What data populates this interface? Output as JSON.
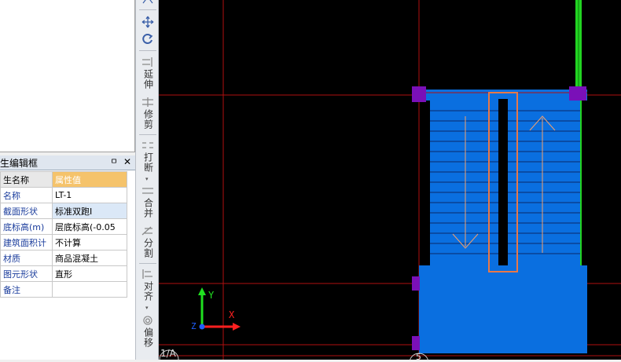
{
  "property_panel": {
    "title": "生编辑框",
    "pin_glyph": "ㅁ",
    "close_glyph": "✕",
    "header": {
      "name_col": "生名称",
      "value_col": "属性值"
    },
    "rows": [
      {
        "name": "名称",
        "value": "LT-1"
      },
      {
        "name": "截面形状",
        "value": "标准双跑I"
      },
      {
        "name": "底标高(m)",
        "value": "层底标高(-0.05"
      },
      {
        "name": "建筑面积计",
        "value": "不计算"
      },
      {
        "name": "材质",
        "value": "商品混凝土"
      },
      {
        "name": "图元形状",
        "value": "直形"
      },
      {
        "name": "备注",
        "value": ""
      }
    ]
  },
  "toolbar": {
    "items": [
      {
        "icon": "move-icon",
        "label": ""
      },
      {
        "icon": "rotate-icon",
        "label": ""
      },
      {
        "icon": "extend-icon",
        "label": "延伸"
      },
      {
        "icon": "trim-icon",
        "label": "修剪"
      },
      {
        "icon": "break-icon",
        "label": "打断"
      },
      {
        "icon": "merge-icon",
        "label": "合并"
      },
      {
        "icon": "split-icon",
        "label": "分割"
      },
      {
        "icon": "align-icon",
        "label": "对齐"
      },
      {
        "icon": "offset-icon",
        "label": "偏移"
      }
    ]
  },
  "canvas": {
    "axis_labels": {
      "x": "X",
      "y": "Y",
      "z": "Z"
    },
    "grid_labels": {
      "left": "1/A",
      "bottom": "5"
    },
    "colors": {
      "background": "#000000",
      "grid_line": "#b01010",
      "stair_fill": "#0a6fe0",
      "wall_green": "#22d422",
      "column_purple": "#7a10b8",
      "rail_orange": "#e87848",
      "axis_x": "#ff2020",
      "axis_y": "#20e020",
      "axis_z": "#2060ff"
    }
  }
}
